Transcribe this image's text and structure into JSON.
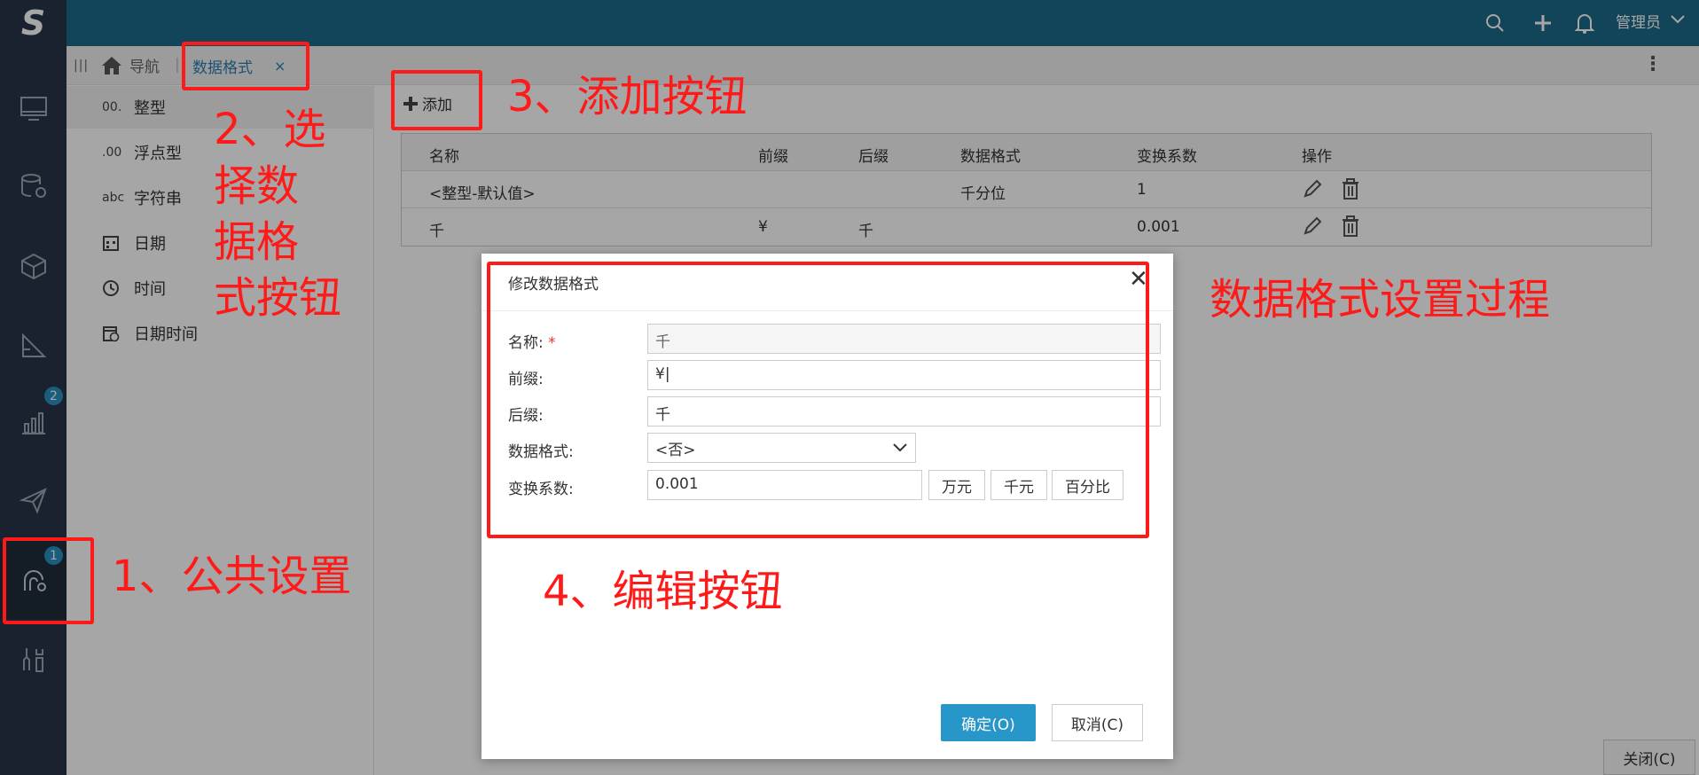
{
  "topbar": {
    "logo": "S",
    "user": "管理员"
  },
  "rail": {
    "badges": {
      "analysis": "2",
      "settings": "1"
    }
  },
  "tabs": {
    "nav_label": "导航",
    "active_label": "数据格式",
    "close_glyph": "×"
  },
  "type_list": [
    {
      "icon": "00.",
      "label": "整型"
    },
    {
      "icon": ".00",
      "label": "浮点型"
    },
    {
      "icon": "abc",
      "label": "字符串"
    },
    {
      "icon": "",
      "label": "日期"
    },
    {
      "icon": "",
      "label": "时间"
    },
    {
      "icon": "",
      "label": "日期时间"
    }
  ],
  "toolbar": {
    "add_label": "添加"
  },
  "grid": {
    "headers": {
      "name": "名称",
      "prefix": "前缀",
      "suffix": "后缀",
      "format": "数据格式",
      "coef": "变换系数",
      "ops": "操作"
    },
    "rows": [
      {
        "name": "<整型-默认值>",
        "prefix": "",
        "suffix": "",
        "format": "千分位",
        "coef": "1"
      },
      {
        "name": "千",
        "prefix": "¥",
        "suffix": "千",
        "format": "",
        "coef": "0.001"
      }
    ]
  },
  "dialog": {
    "title": "修改数据格式",
    "fields": {
      "name_label": "名称:",
      "required_mark": "*",
      "name_value": "千",
      "prefix_label": "前缀:",
      "prefix_value": "¥|",
      "suffix_label": "后缀:",
      "suffix_value": "千",
      "format_label": "数据格式:",
      "format_value": "<否>",
      "coef_label": "变换系数:",
      "coef_value": "0.001"
    },
    "units": [
      "万元",
      "千元",
      "百分比"
    ],
    "ok_label": "确定(O)",
    "cancel_label": "取消(C)"
  },
  "close_label": "关闭(C)",
  "annotations": {
    "a1": "1、公共设置",
    "a2_lines": [
      "2、选",
      "择数",
      "据格",
      "式按钮"
    ],
    "a3": "3、添加按钮",
    "a4": "4、编辑按钮",
    "process": "数据格式设置过程"
  },
  "colors": {
    "topbar": "#1e6a8a",
    "rail": "#273547",
    "accent": "#2796c9",
    "annotation": "#ff1a1a"
  }
}
